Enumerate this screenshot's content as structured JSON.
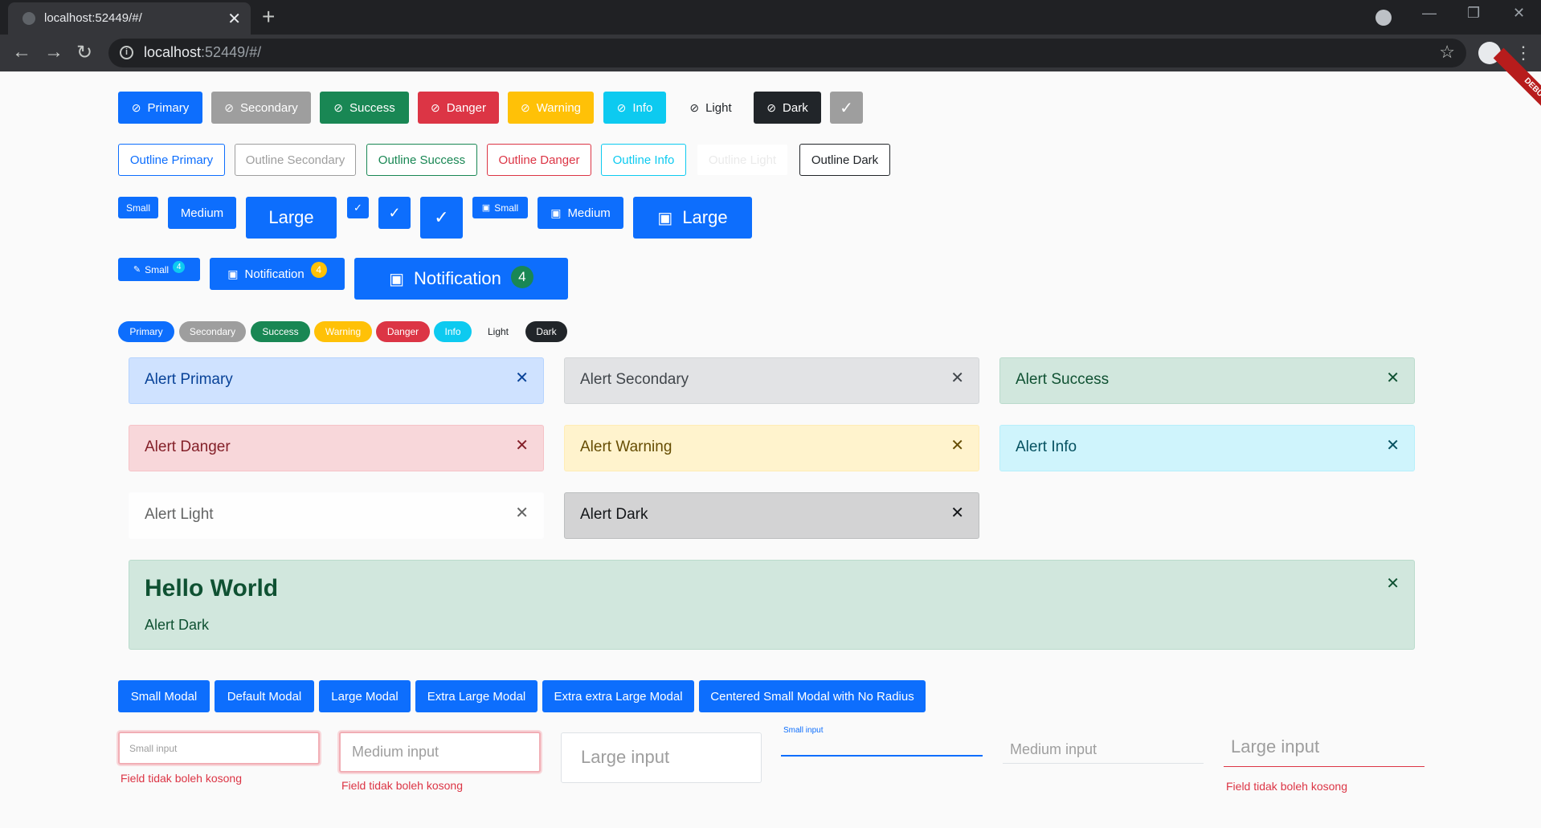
{
  "browser": {
    "tab_title": "localhost:52449/#/",
    "url_host": "localhost",
    "url_path": ":52449/#/"
  },
  "debug_banner": "DEBUG",
  "buttons": {
    "primary": "Primary",
    "secondary": "Secondary",
    "success": "Success",
    "danger": "Danger",
    "warning": "Warning",
    "info": "Info",
    "light": "Light",
    "dark": "Dark"
  },
  "outline_buttons": [
    "Outline Primary",
    "Outline Secondary",
    "Outline Success",
    "Outline Danger",
    "Outline Info",
    "Outline Light",
    "Outline Dark"
  ],
  "sizes": {
    "small": "Small",
    "medium": "Medium",
    "large": "Large"
  },
  "notifications": {
    "small": "Small",
    "small_count": "4",
    "medium": "Notification",
    "medium_count": "4",
    "large": "Notification",
    "large_count": "4"
  },
  "pills": [
    "Primary",
    "Secondary",
    "Success",
    "Warning",
    "Danger",
    "Info",
    "Light",
    "Dark"
  ],
  "alerts": {
    "primary": "Alert Primary",
    "secondary": "Alert Secondary",
    "success": "Alert Success",
    "danger": "Alert Danger",
    "warning": "Alert Warning",
    "info": "Alert Info",
    "light": "Alert Light",
    "dark": "Alert Dark",
    "heading_title": "Hello World",
    "heading_body": "Alert Dark"
  },
  "modals": [
    "Small Modal",
    "Default Modal",
    "Large Modal",
    "Extra Large Modal",
    "Extra extra Large Modal",
    "Centered Small Modal with No Radius"
  ],
  "inputs": {
    "small_placeholder": "Small input",
    "medium_placeholder": "Medium input",
    "large_placeholder": "Large input",
    "floating_small_label": "Small input",
    "underline_medium_placeholder": "Medium input",
    "underline_large_placeholder": "Large input",
    "error_message": "Field tidak boleh kosong"
  },
  "colors": {
    "primary": "#0d6efd",
    "secondary": "#9e9e9e",
    "success": "#198754",
    "danger": "#dc3545",
    "warning": "#ffc107",
    "info": "#0dcaf0",
    "dark": "#212529"
  }
}
